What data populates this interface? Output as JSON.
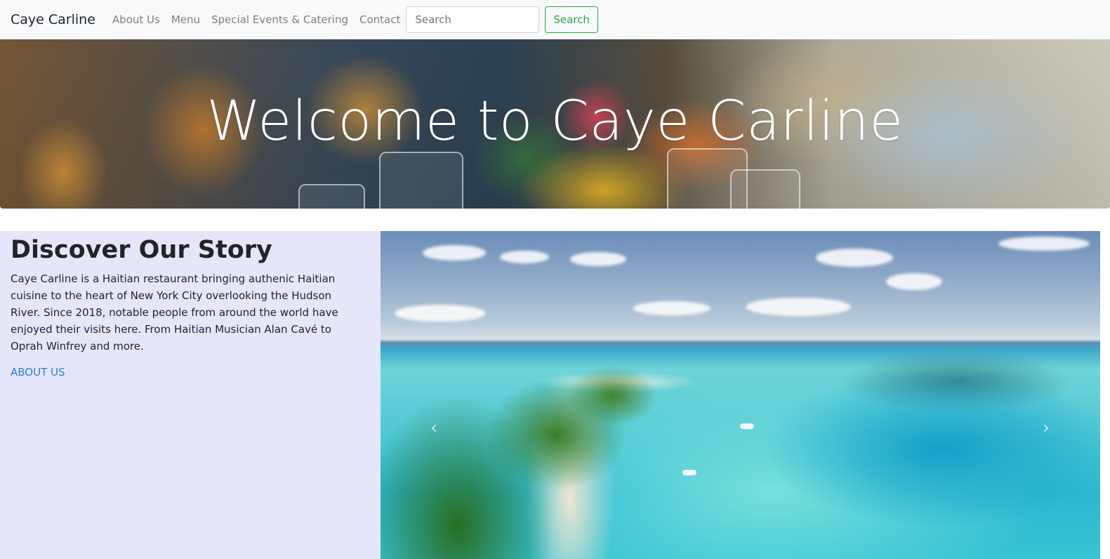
{
  "navbar": {
    "brand": "Caye Carline",
    "links": [
      "About Us",
      "Menu",
      "Special Events & Catering",
      "Contact"
    ],
    "search_placeholder": "Search",
    "search_button": "Search"
  },
  "hero": {
    "title": "Welcome to Caye Carline"
  },
  "story": {
    "title": "Discover Our Story",
    "text": "Caye Carline is a Haitian restaurant bringing authenic Haitian cuisine to the heart of New York City overlooking the Hudson River. Since 2018, notable people from around the world have enjoyed their visits here. From Haitian Musician Alan Cavé to Oprah Winfrey and more.",
    "link": "ABOUT US"
  },
  "carousel": {
    "prev_icon": "chevron-left-icon",
    "next_icon": "chevron-right-icon"
  }
}
